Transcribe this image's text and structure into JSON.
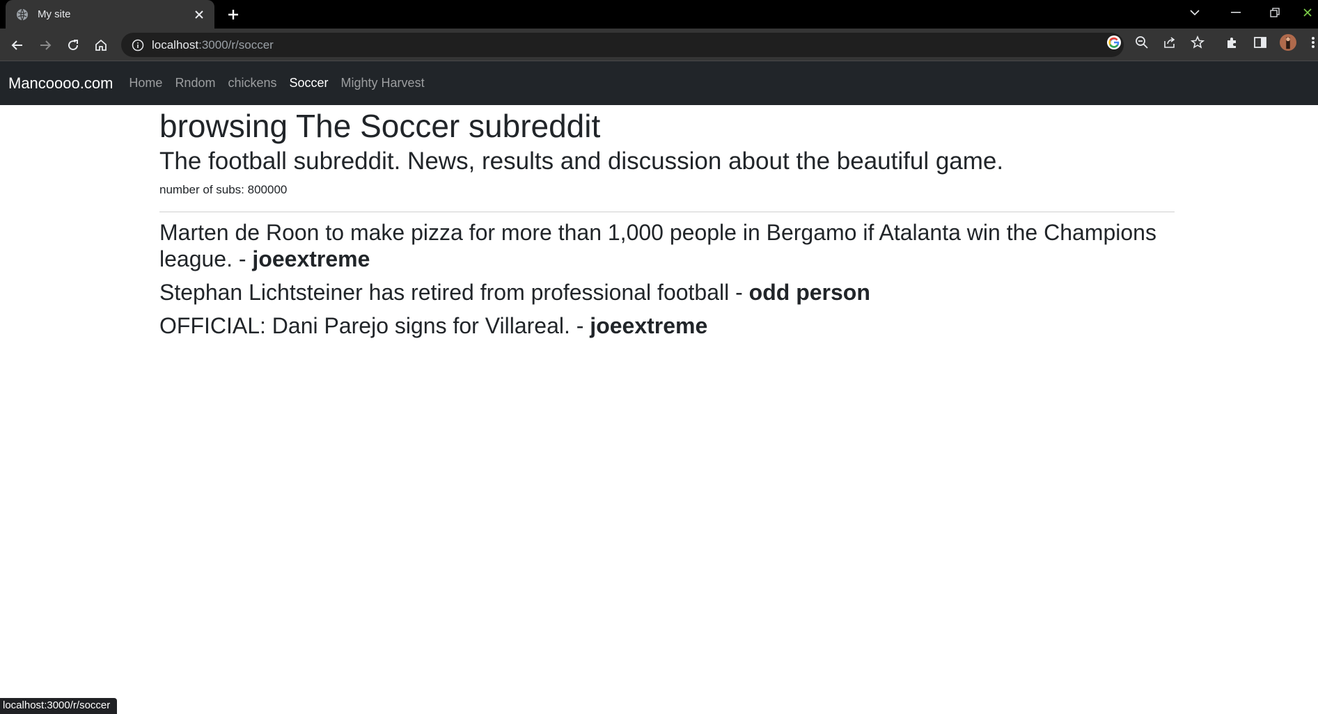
{
  "browser": {
    "tab_title": "My site",
    "url_host": "localhost",
    "url_rest": ":3000/r/soccer"
  },
  "navbar": {
    "brand": "Mancoooo.com",
    "links": [
      {
        "label": "Home"
      },
      {
        "label": "Rndom"
      },
      {
        "label": "chickens"
      },
      {
        "label": "Soccer"
      },
      {
        "label": "Mighty Harvest"
      }
    ]
  },
  "page": {
    "heading": "browsing The Soccer subreddit",
    "description": "The football subreddit. News, results and discussion about the beautiful game.",
    "subs": "number of subs: 800000",
    "posts": [
      {
        "title": "Marten de Roon to make pizza for more than 1,000 people in Bergamo if Atalanta win the Champions league.",
        "sep": " - ",
        "author": "joeextreme"
      },
      {
        "title": "Stephan Lichtsteiner has retired from professional football",
        "sep": " - ",
        "author": "odd person"
      },
      {
        "title": "OFFICIAL: Dani Parejo signs for Villareal.",
        "sep": " - ",
        "author": "joeextreme"
      }
    ]
  },
  "status": {
    "text": "localhost:3000/r/soccer"
  }
}
